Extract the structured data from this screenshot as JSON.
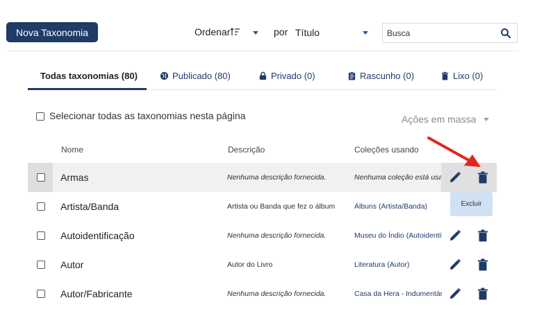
{
  "header": {
    "new_button": "Nova Taxonomia",
    "sort_label": "Ordenar",
    "por_label": "por",
    "sort_field": "Título",
    "search_placeholder": "Busca"
  },
  "tabs": [
    {
      "label": "Todas taxonomias (80)",
      "icon": "none",
      "active": true
    },
    {
      "label": "Publicado (80)",
      "icon": "globe-icon"
    },
    {
      "label": "Privado (0)",
      "icon": "lock-icon"
    },
    {
      "label": "Rascunho (0)",
      "icon": "clipboard-icon"
    },
    {
      "label": "Lixo (0)",
      "icon": "trash-icon"
    }
  ],
  "bulk": {
    "select_all_label": "Selecionar todas as taxonomias nesta página",
    "actions_label": "Ações em massa"
  },
  "columns": {
    "name": "Nome",
    "description": "Descrição",
    "collections": "Coleções usando"
  },
  "rows": [
    {
      "name": "Armas",
      "description": "Nenhuma descrição fornecida.",
      "collections": "Nenhuma coleção está usando",
      "desc_italic": true,
      "coll_italic": true
    },
    {
      "name": "Artista/Banda",
      "description": "Artista ou Banda que fez o álbum",
      "collections": "Álbuns (Artista/Banda)",
      "desc_italic": false,
      "coll_italic": false
    },
    {
      "name": "Autoidentificação",
      "description": "Nenhuma descrição fornecida.",
      "collections": "Museu do Índio (Autoidentificação)",
      "desc_italic": true,
      "coll_italic": false
    },
    {
      "name": "Autor",
      "description": "Autor do Livro",
      "collections": "Literatura (Autor)",
      "desc_italic": false,
      "coll_italic": false
    },
    {
      "name": "Autor/Fabricante",
      "description": "Nenhuma descrição fornecida.",
      "collections": "Casa da Hera - Indumentária",
      "desc_italic": true,
      "coll_italic": false
    }
  ],
  "tooltip": "Excluir",
  "colors": {
    "primary": "#1f3b66",
    "accent_arrow": "#e3261c",
    "tooltip_bg": "#cfe1f3"
  }
}
